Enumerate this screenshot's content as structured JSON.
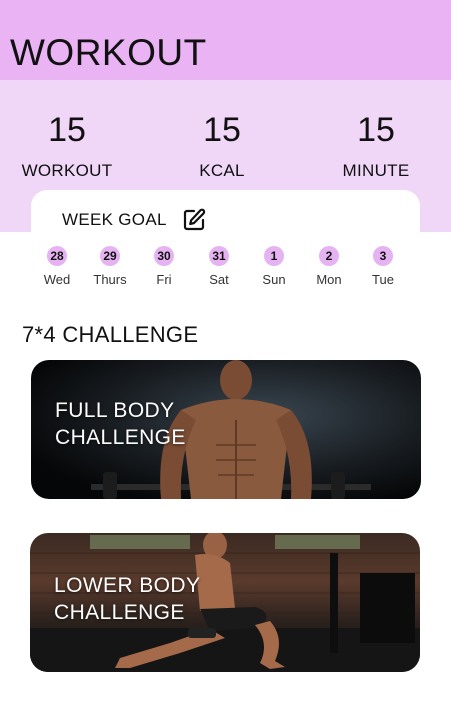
{
  "header": {
    "title": "WORKOUT"
  },
  "stats": [
    {
      "value": "15",
      "label": "WORKOUT"
    },
    {
      "value": "15",
      "label": "KCAL"
    },
    {
      "value": "15",
      "label": "MINUTE"
    }
  ],
  "week_goal": {
    "title": "WEEK GOAL",
    "edit_icon": "edit-pencil-icon",
    "days": [
      {
        "date": "28",
        "label": "Wed"
      },
      {
        "date": "29",
        "label": "Thurs"
      },
      {
        "date": "30",
        "label": "Fri"
      },
      {
        "date": "31",
        "label": "Sat"
      },
      {
        "date": "1",
        "label": "Sun"
      },
      {
        "date": "2",
        "label": "Mon"
      },
      {
        "date": "3",
        "label": "Tue"
      }
    ]
  },
  "section": {
    "title": "7*4 CHALLENGE"
  },
  "challenges": [
    {
      "line1": "FULL BODY",
      "line2": "CHALLENGE"
    },
    {
      "line1": "LOWER BODY",
      "line2": "CHALLENGE"
    }
  ],
  "colors": {
    "header_bg": "#e9b3f4",
    "stats_bg": "#f0d6f7",
    "day_badge": "#e6b3f2"
  }
}
